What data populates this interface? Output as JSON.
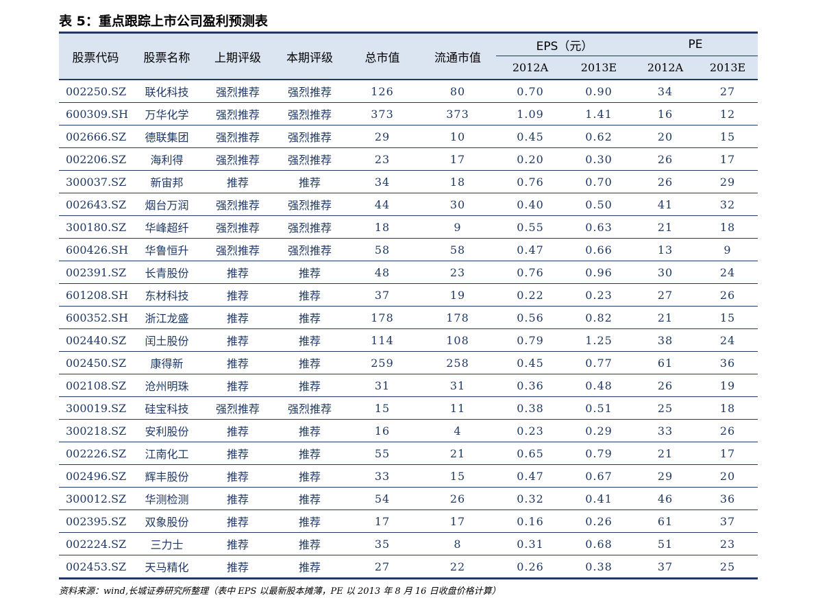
{
  "title": "表 5：重点跟踪上市公司盈利预测表",
  "header": {
    "code": "股票代码",
    "name": "股票名称",
    "prev_rating": "上期评级",
    "curr_rating": "本期评级",
    "market_cap": "总市值",
    "float_cap": "流通市值",
    "eps_group": "EPS（元）",
    "pe_group": "PE",
    "eps_2012": "2012A",
    "eps_2013": "2013E",
    "pe_2012": "2012A",
    "pe_2013": "2013E"
  },
  "rows": [
    [
      "002250.SZ",
      "联化科技",
      "强烈推荐",
      "强烈推荐",
      "126",
      "80",
      "0.70",
      "0.90",
      "34",
      "27"
    ],
    [
      "600309.SH",
      "万华化学",
      "强烈推荐",
      "强烈推荐",
      "373",
      "373",
      "1.09",
      "1.41",
      "16",
      "12"
    ],
    [
      "002666.SZ",
      "德联集团",
      "强烈推荐",
      "强烈推荐",
      "29",
      "10",
      "0.45",
      "0.62",
      "20",
      "15"
    ],
    [
      "002206.SZ",
      "海利得",
      "强烈推荐",
      "强烈推荐",
      "23",
      "17",
      "0.20",
      "0.30",
      "26",
      "17"
    ],
    [
      "300037.SZ",
      "新宙邦",
      "推荐",
      "推荐",
      "34",
      "18",
      "0.76",
      "0.70",
      "26",
      "29"
    ],
    [
      "002643.SZ",
      "烟台万润",
      "强烈推荐",
      "强烈推荐",
      "44",
      "30",
      "0.40",
      "0.50",
      "41",
      "32"
    ],
    [
      "300180.SZ",
      "华峰超纤",
      "强烈推荐",
      "强烈推荐",
      "18",
      "9",
      "0.55",
      "0.63",
      "21",
      "18"
    ],
    [
      "600426.SH",
      "华鲁恒升",
      "强烈推荐",
      "强烈推荐",
      "58",
      "58",
      "0.47",
      "0.66",
      "13",
      "9"
    ],
    [
      "002391.SZ",
      "长青股份",
      "推荐",
      "推荐",
      "48",
      "23",
      "0.76",
      "0.96",
      "30",
      "24"
    ],
    [
      "601208.SH",
      "东材科技",
      "推荐",
      "推荐",
      "37",
      "19",
      "0.22",
      "0.23",
      "27",
      "26"
    ],
    [
      "600352.SH",
      "浙江龙盛",
      "推荐",
      "推荐",
      "178",
      "178",
      "0.56",
      "0.82",
      "21",
      "15"
    ],
    [
      "002440.SZ",
      "闰土股份",
      "推荐",
      "推荐",
      "114",
      "108",
      "0.79",
      "1.25",
      "38",
      "24"
    ],
    [
      "002450.SZ",
      "康得新",
      "推荐",
      "推荐",
      "259",
      "258",
      "0.45",
      "0.77",
      "61",
      "36"
    ],
    [
      "002108.SZ",
      "沧州明珠",
      "推荐",
      "推荐",
      "31",
      "31",
      "0.36",
      "0.48",
      "26",
      "19"
    ],
    [
      "300019.SZ",
      "硅宝科技",
      "强烈推荐",
      "强烈推荐",
      "15",
      "11",
      "0.38",
      "0.51",
      "25",
      "18"
    ],
    [
      "300218.SZ",
      "安利股份",
      "推荐",
      "推荐",
      "16",
      "4",
      "0.23",
      "0.29",
      "33",
      "26"
    ],
    [
      "002226.SZ",
      "江南化工",
      "推荐",
      "推荐",
      "55",
      "21",
      "0.65",
      "0.79",
      "21",
      "17"
    ],
    [
      "002496.SZ",
      "辉丰股份",
      "推荐",
      "推荐",
      "33",
      "15",
      "0.47",
      "0.67",
      "29",
      "20"
    ],
    [
      "300012.SZ",
      "华测检测",
      "推荐",
      "推荐",
      "54",
      "26",
      "0.32",
      "0.41",
      "46",
      "36"
    ],
    [
      "002395.SZ",
      "双象股份",
      "推荐",
      "推荐",
      "17",
      "17",
      "0.16",
      "0.26",
      "61",
      "37"
    ],
    [
      "002224.SZ",
      "三力士",
      "推荐",
      "推荐",
      "35",
      "8",
      "0.31",
      "0.68",
      "51",
      "23"
    ],
    [
      "002453.SZ",
      "天马精化",
      "推荐",
      "推荐",
      "27",
      "22",
      "0.26",
      "0.38",
      "37",
      "25"
    ]
  ],
  "source": "资料来源：wind,长城证券研究所整理（表中 EPS 以最新股本摊薄，PE 以 2013 年 8 月 16 日收盘价格计算）"
}
